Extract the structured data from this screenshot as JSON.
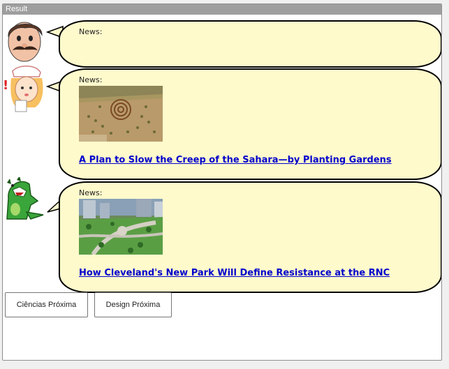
{
  "window": {
    "title": "Result"
  },
  "messages": [
    {
      "avatar": "mustache-man-avatar",
      "label": "News:",
      "headline": "",
      "thumbnail": ""
    },
    {
      "avatar": "nurse-girl-avatar",
      "label": "News:",
      "headline": "A Plan to Slow the Creep of the Sahara—by Planting Gardens",
      "thumbnail": "sahara-garden-aerial-photo"
    },
    {
      "avatar": "green-dinosaur-avatar",
      "label": "News:",
      "headline": "How Cleveland's New Park Will Define Resistance at the RNC",
      "thumbnail": "cleveland-park-aerial-photo"
    }
  ],
  "buttons": {
    "ciencias": "Ciências Próxima",
    "design": "Design Próxima"
  },
  "colors": {
    "bubble": "#fffacc",
    "link": "#0000cc",
    "titlebar": "#9e9e9e"
  }
}
